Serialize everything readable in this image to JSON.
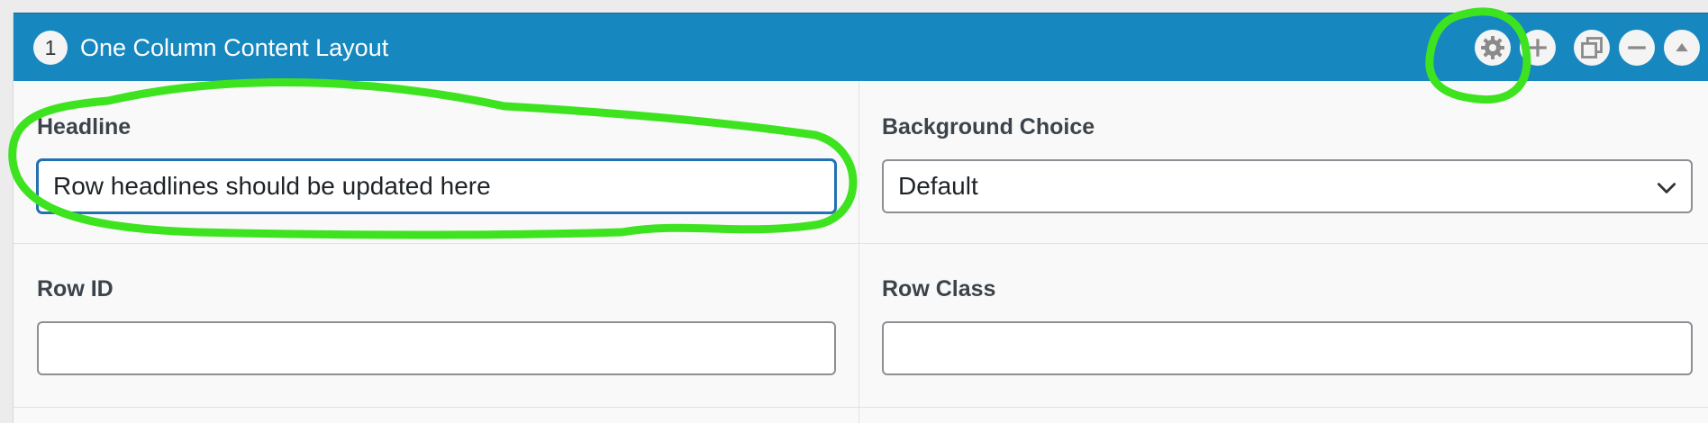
{
  "layout": {
    "row_number": "1",
    "title": "One Column Content Layout",
    "actions": [
      {
        "name": "settings",
        "icon": "gear-icon"
      },
      {
        "name": "add",
        "icon": "plus-icon"
      },
      {
        "name": "duplicate",
        "icon": "duplicate-icon"
      },
      {
        "name": "collapse",
        "icon": "minus-icon"
      },
      {
        "name": "toggle",
        "icon": "triangle-up-icon"
      }
    ]
  },
  "fields": {
    "headline": {
      "label": "Headline",
      "value": "Row headlines should be updated here",
      "placeholder": ""
    },
    "background_choice": {
      "label": "Background Choice",
      "selected": "Default",
      "icon": "chevron-down-icon"
    },
    "row_id": {
      "label": "Row ID",
      "value": "",
      "placeholder": ""
    },
    "row_class": {
      "label": "Row Class",
      "value": "",
      "placeholder": ""
    }
  },
  "colors": {
    "header_bg": "#1788bf",
    "annotation": "#3ee31f",
    "focus_border": "#2271b1"
  }
}
